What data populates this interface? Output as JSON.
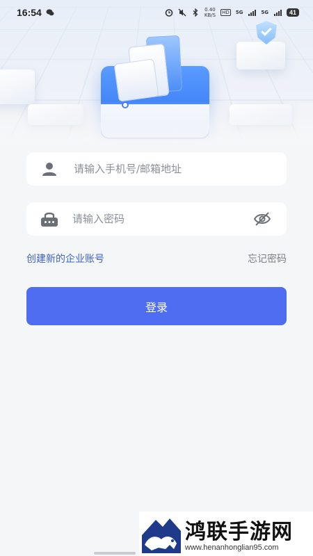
{
  "status_bar": {
    "time": "16:54",
    "net_speed_value": "0.40",
    "net_speed_unit": "KB/S",
    "network_1": "5G",
    "network_2": "5G",
    "hd_label": "HD",
    "battery": "41"
  },
  "form": {
    "account_placeholder": "请输入手机号/邮箱地址",
    "account_value": "",
    "password_placeholder": "请输入密码",
    "password_value": ""
  },
  "links": {
    "create_account": "创建新的企业账号",
    "forgot_password": "忘记密码"
  },
  "buttons": {
    "login": "登录"
  },
  "watermark": {
    "title": "鸿联手游网",
    "url": "www.henanhonglian95.com"
  },
  "colors": {
    "primary": "#4e6df0",
    "link": "#3d63c8",
    "background": "#f5f6f8"
  },
  "icons": {
    "account": "user-icon",
    "password": "lock-icon",
    "visibility": "eye-off-icon"
  }
}
